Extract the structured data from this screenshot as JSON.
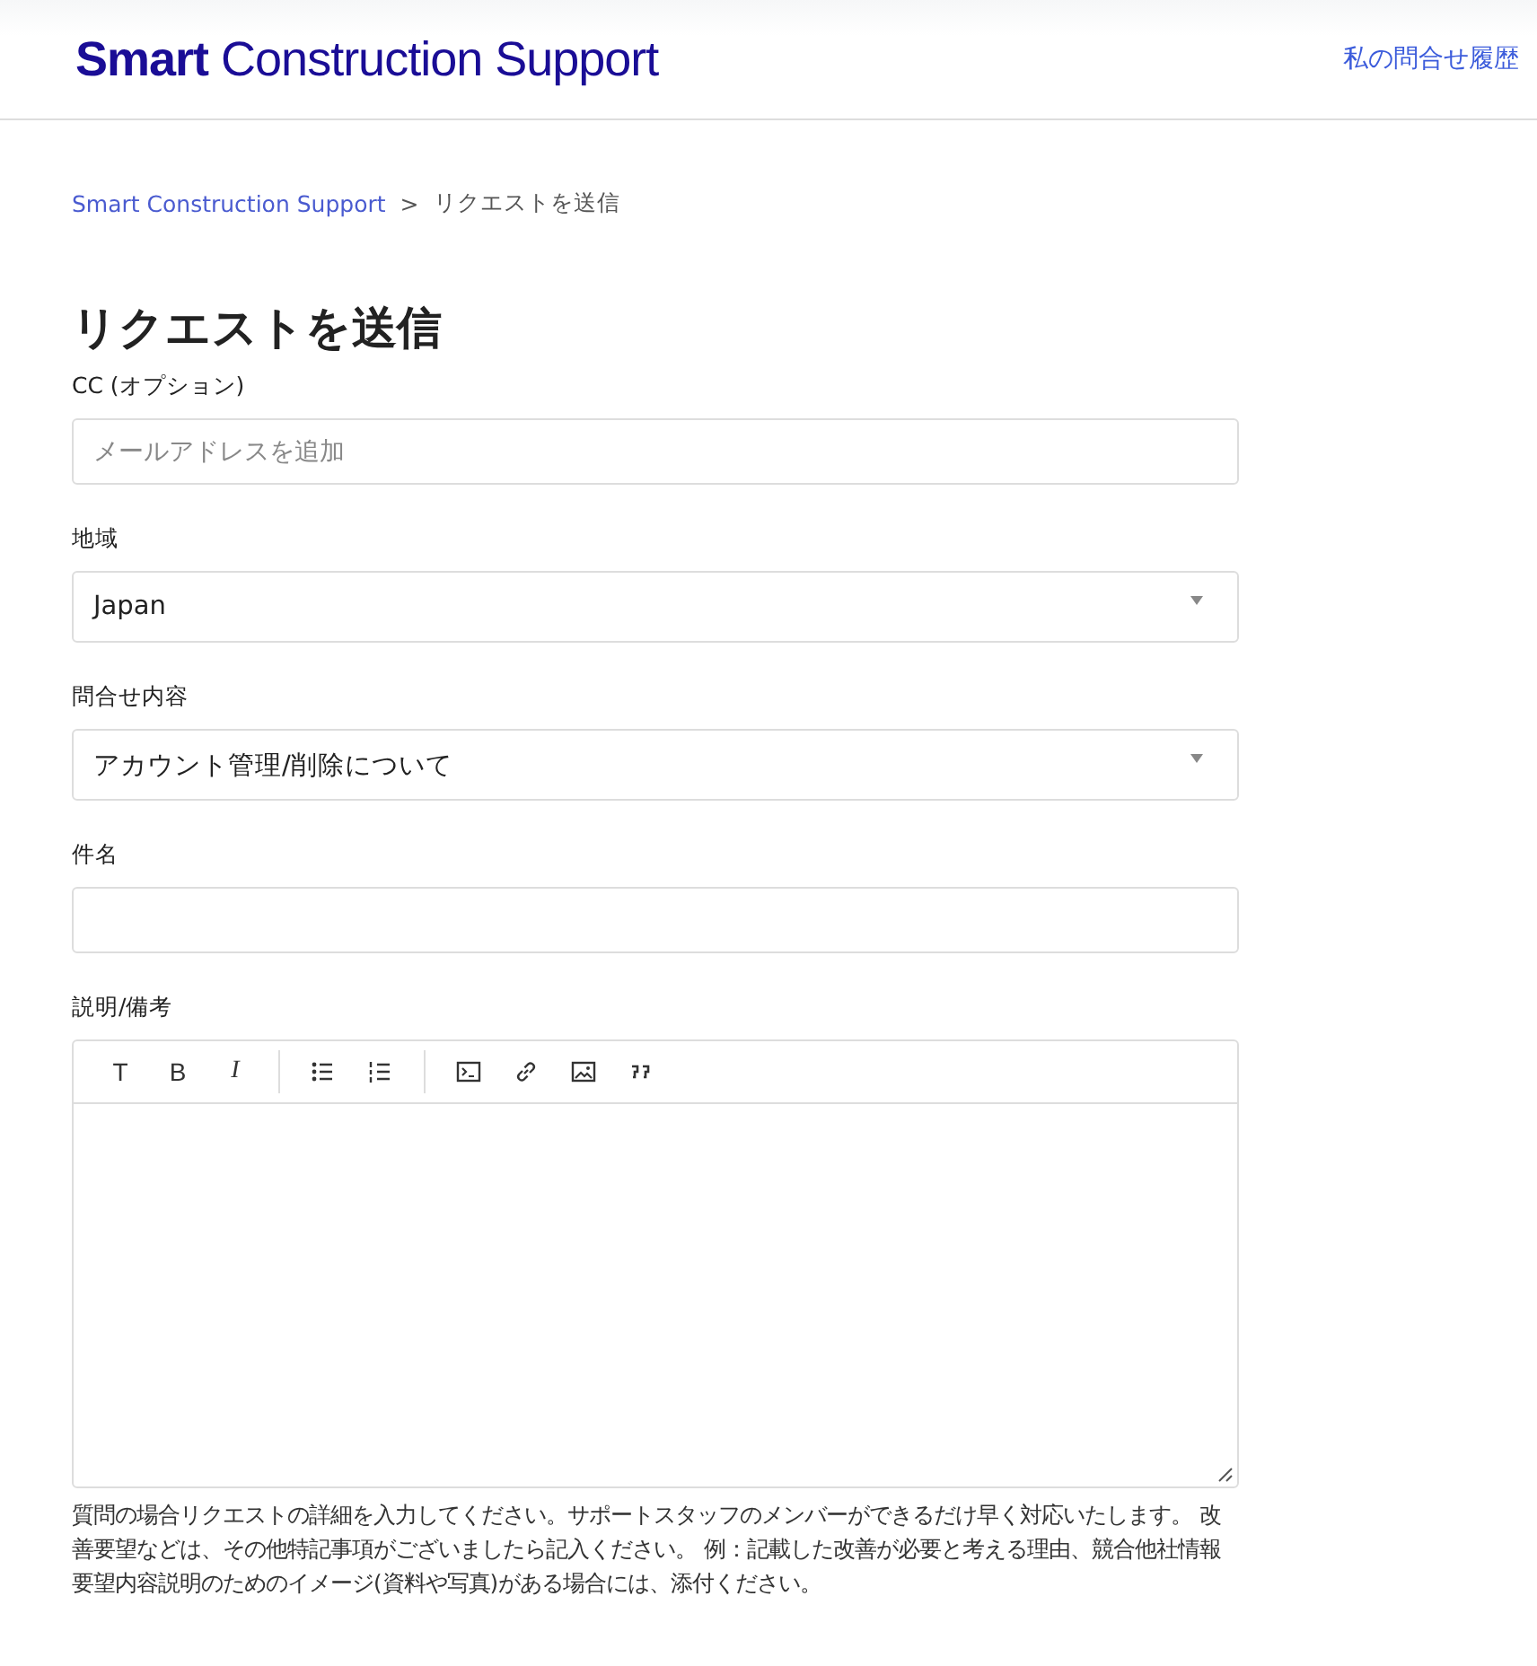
{
  "header": {
    "logo": "**Smart** Construction Support",
    "link": "私の問合せ履歴"
  },
  "breadcrumb": [
    {
      "label": "Smart Construction Support",
      "kind": "link"
    },
    {
      "label": ">",
      "kind": "separator"
    },
    {
      "label": "リクエストを送信",
      "kind": "current"
    }
  ],
  "title": "リクエストを送信",
  "fields": [
    {
      "kind": "text",
      "label": "CC (オプション)",
      "placeholder": "メールアドレスを追加"
    },
    {
      "kind": "select",
      "label": "地域",
      "value": "Japan"
    },
    {
      "kind": "select",
      "label": "問合せ内容",
      "value": "アカウント管理/削除について"
    },
    {
      "kind": "text",
      "label": "件名"
    },
    {
      "kind": "editor",
      "label": "説明/備考",
      "toolbar": [
        {
          "kind": "char",
          "text": "T"
        },
        {
          "kind": "char",
          "text": "B"
        },
        {
          "kind": "char",
          "text": "I"
        },
        {
          "kind": "divider"
        },
        {
          "kind": "bullet-list"
        },
        {
          "kind": "number-list"
        },
        {
          "kind": "divider"
        },
        {
          "kind": "code"
        },
        {
          "kind": "link"
        },
        {
          "kind": "image"
        },
        {
          "kind": "quote"
        }
      ],
      "help": "質問の場合リクエストの詳細を入力してください。サポートスタッフのメンバーができるだけ早く対応いたします。 改善要望などは、その他特記事項がございましたら記入ください。 例：記載した改善が必要と考える理由、競合他社情報要望内容説明のためのイメージ(資料や写真)がある場合には、添付ください。"
    }
  ]
}
